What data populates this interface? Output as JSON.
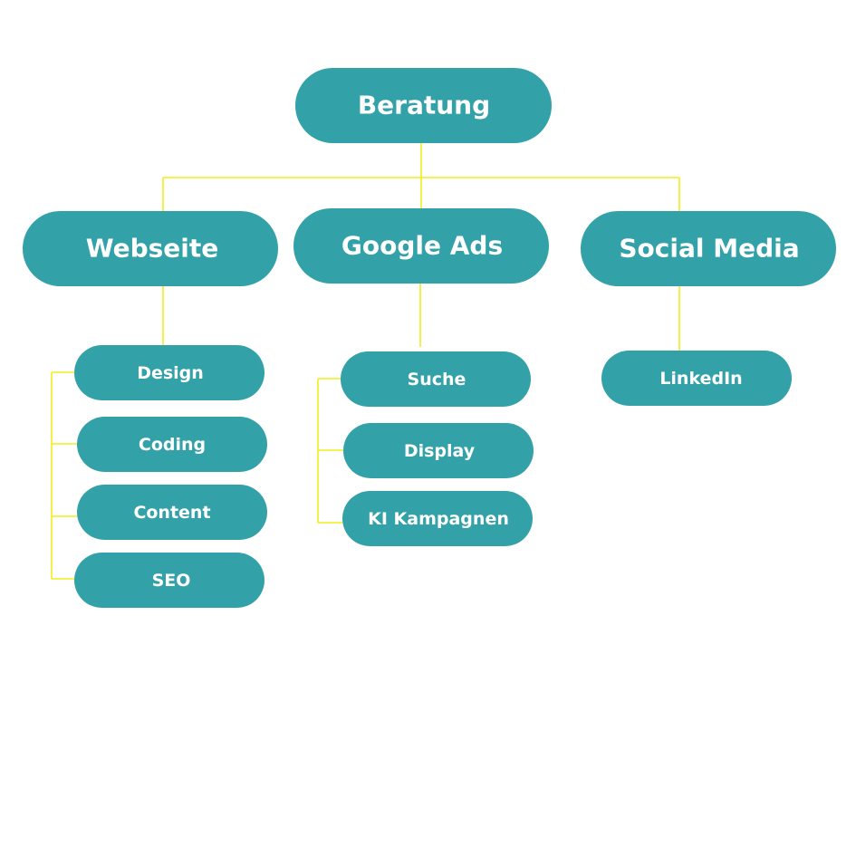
{
  "colors": {
    "node": "#33A1A8",
    "connector": "#F2EE1C",
    "text": "#FFFFFF"
  },
  "root": {
    "label": "Beratung"
  },
  "branches": [
    {
      "label": "Webseite",
      "children": [
        "Design",
        "Coding",
        "Content",
        "SEO"
      ]
    },
    {
      "label": "Google Ads",
      "children": [
        "Suche",
        "Display",
        "KI Kampagnen"
      ]
    },
    {
      "label": "Social Media",
      "children": [
        "LinkedIn"
      ]
    }
  ]
}
